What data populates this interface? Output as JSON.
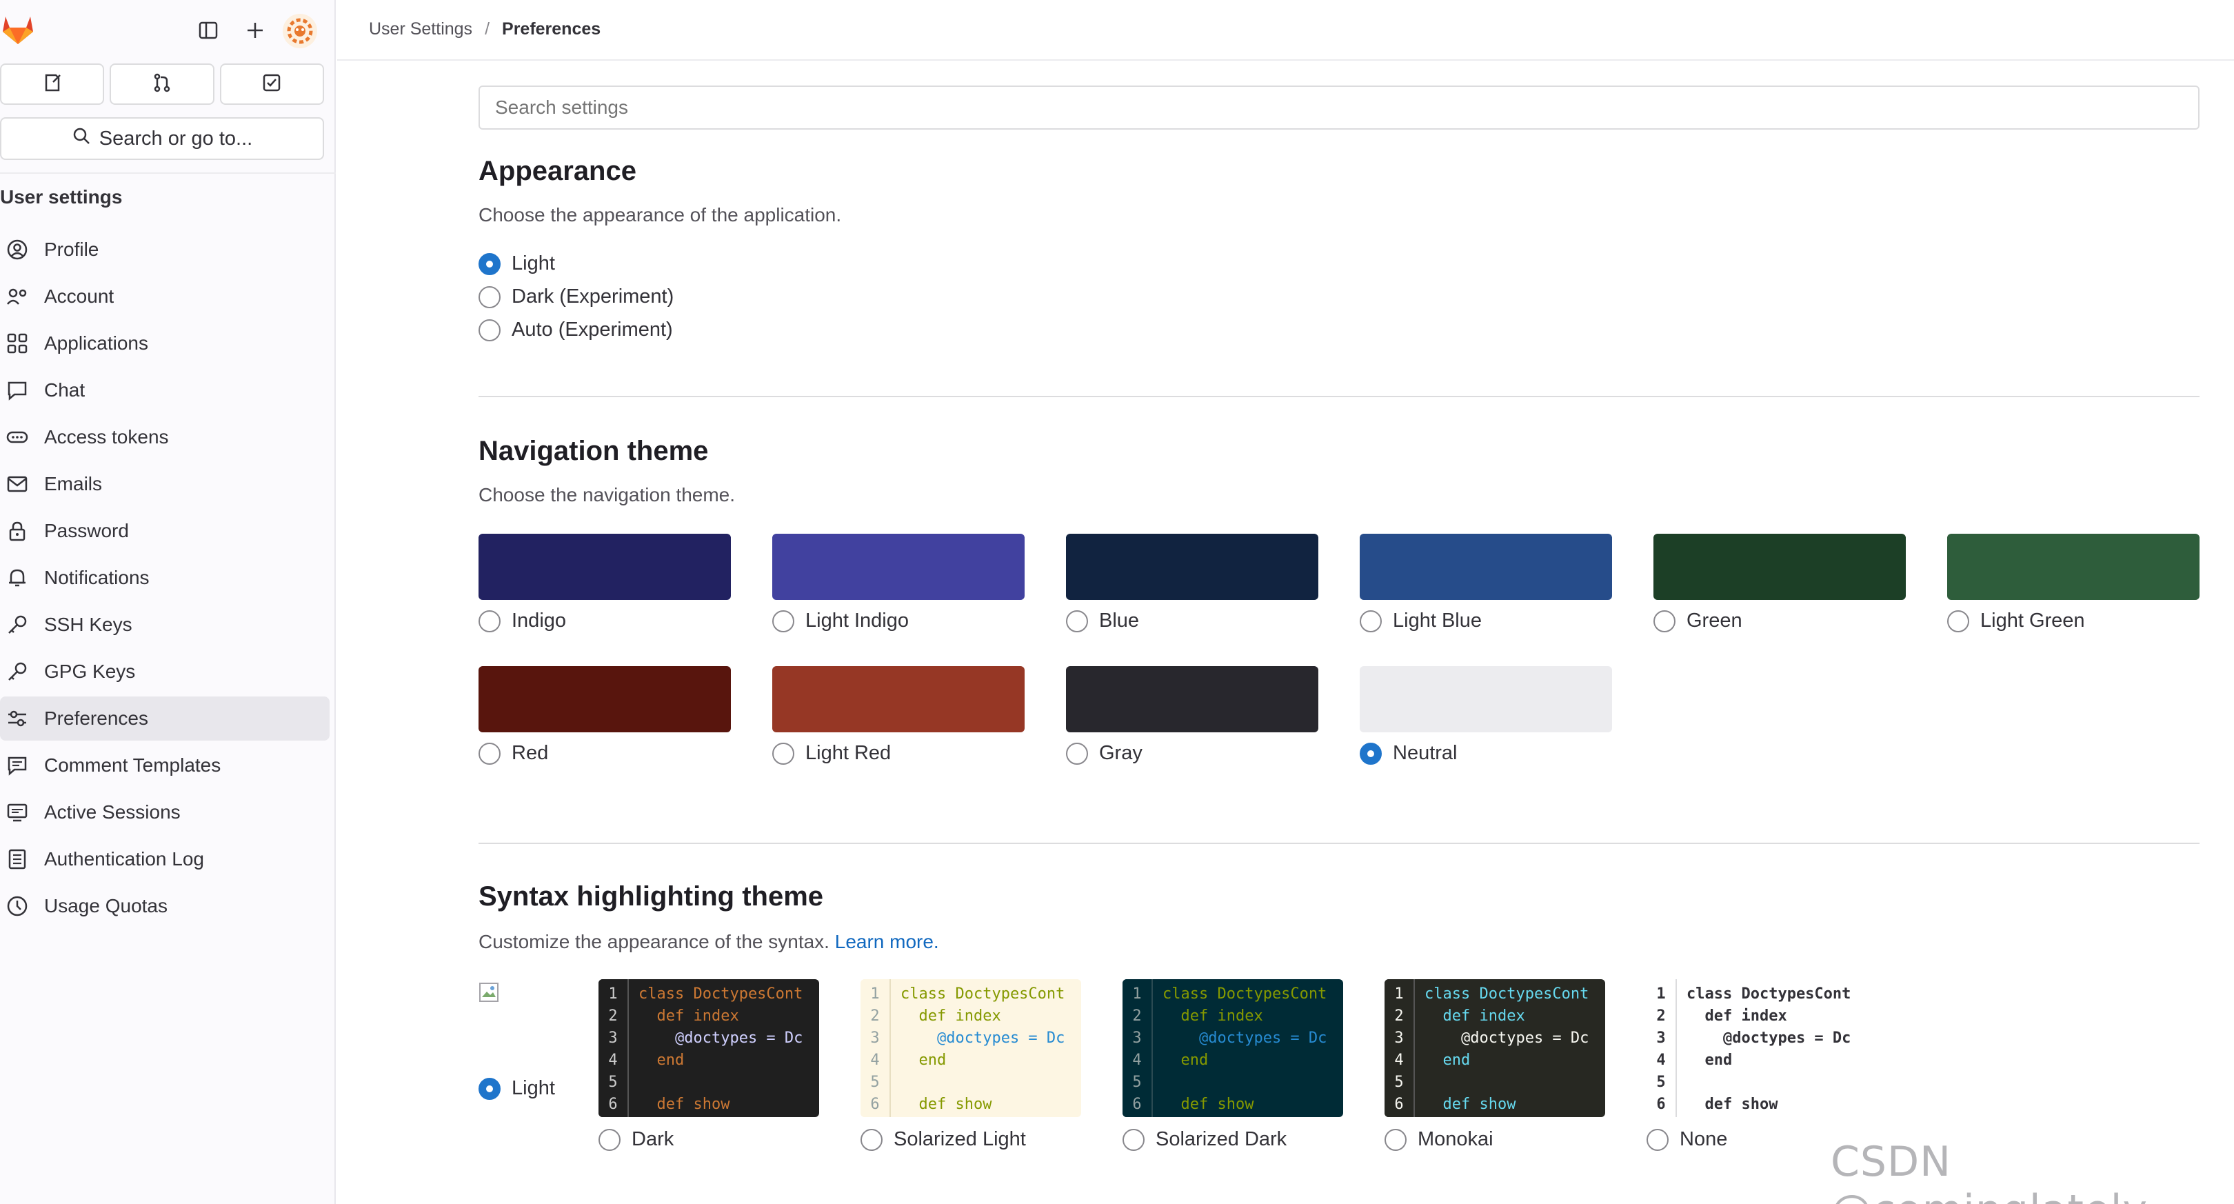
{
  "colors": {
    "accent": "#1f75cb",
    "link": "#1068bf",
    "sidebar_bg": "#fbfafd",
    "active_item": "#e8e7ec"
  },
  "sidebar": {
    "heading": "User settings",
    "search_label": "Search or go to...",
    "items": [
      {
        "label": "Profile",
        "icon": "profile-icon"
      },
      {
        "label": "Account",
        "icon": "account-icon"
      },
      {
        "label": "Applications",
        "icon": "applications-icon"
      },
      {
        "label": "Chat",
        "icon": "chat-icon"
      },
      {
        "label": "Access tokens",
        "icon": "token-icon"
      },
      {
        "label": "Emails",
        "icon": "mail-icon"
      },
      {
        "label": "Password",
        "icon": "lock-icon"
      },
      {
        "label": "Notifications",
        "icon": "bell-icon"
      },
      {
        "label": "SSH Keys",
        "icon": "key-icon"
      },
      {
        "label": "GPG Keys",
        "icon": "key-icon"
      },
      {
        "label": "Preferences",
        "icon": "preferences-icon",
        "active": true
      },
      {
        "label": "Comment Templates",
        "icon": "comment-icon"
      },
      {
        "label": "Active Sessions",
        "icon": "monitor-icon"
      },
      {
        "label": "Authentication Log",
        "icon": "log-icon"
      },
      {
        "label": "Usage Quotas",
        "icon": "quota-icon"
      }
    ]
  },
  "breadcrumb": {
    "parent": "User Settings",
    "separator": "/",
    "current": "Preferences"
  },
  "search": {
    "placeholder": "Search settings"
  },
  "appearance": {
    "title": "Appearance",
    "description": "Choose the appearance of the application.",
    "options": [
      {
        "label": "Light",
        "checked": true
      },
      {
        "label": "Dark (Experiment)",
        "checked": false
      },
      {
        "label": "Auto (Experiment)",
        "checked": false
      }
    ]
  },
  "navigation_theme": {
    "title": "Navigation theme",
    "description": "Choose the navigation theme.",
    "themes": [
      {
        "label": "Indigo",
        "color": "#222261",
        "checked": false
      },
      {
        "label": "Light Indigo",
        "color": "#41419f",
        "checked": false
      },
      {
        "label": "Blue",
        "color": "#112340",
        "checked": false
      },
      {
        "label": "Light Blue",
        "color": "#264c8a",
        "checked": false
      },
      {
        "label": "Green",
        "color": "#1c3f26",
        "checked": false
      },
      {
        "label": "Light Green",
        "color": "#2e5d3b",
        "checked": false
      },
      {
        "label": "Red",
        "color": "#58150d",
        "checked": false
      },
      {
        "label": "Light Red",
        "color": "#963725",
        "checked": false
      },
      {
        "label": "Gray",
        "color": "#28272d",
        "checked": false
      },
      {
        "label": "Neutral",
        "color": "#ececef",
        "checked": true
      }
    ]
  },
  "syntax_theme": {
    "title": "Syntax highlighting theme",
    "description": "Customize the appearance of the syntax.",
    "learn_more": "Learn more.",
    "light_option": {
      "label": "Light",
      "checked": true
    },
    "line_numbers": [
      "1",
      "2",
      "3",
      "4",
      "5",
      "6"
    ],
    "code_lines": [
      "class DoctypesCont",
      "  def index",
      "    @doctypes = Dc",
      "  end",
      "",
      "  def show"
    ],
    "themes": [
      {
        "label": "Dark",
        "checked": false
      },
      {
        "label": "Solarized Light",
        "checked": false
      },
      {
        "label": "Solarized Dark",
        "checked": false
      },
      {
        "label": "Monokai",
        "checked": false
      },
      {
        "label": "None",
        "checked": false
      }
    ]
  },
  "watermark": "CSDN @cominglately"
}
